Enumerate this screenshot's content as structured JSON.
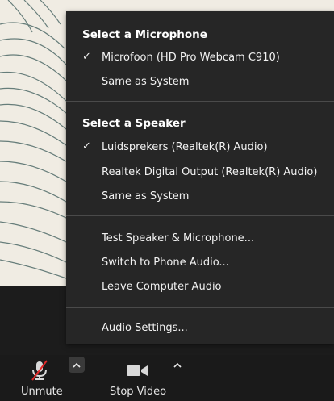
{
  "menu": {
    "microphone_header": "Select a Microphone",
    "microphones": [
      {
        "label": "Microfoon (HD Pro Webcam C910)",
        "checked": true
      },
      {
        "label": "Same as System",
        "checked": false
      }
    ],
    "speaker_header": "Select a Speaker",
    "speakers": [
      {
        "label": "Luidsprekers (Realtek(R) Audio)",
        "checked": true
      },
      {
        "label": "Realtek Digital Output (Realtek(R) Audio)",
        "checked": false
      },
      {
        "label": "Same as System",
        "checked": false
      }
    ],
    "actions": [
      {
        "label": "Test Speaker & Microphone..."
      },
      {
        "label": "Switch to Phone Audio..."
      },
      {
        "label": "Leave Computer Audio"
      }
    ],
    "settings": {
      "label": "Audio Settings..."
    },
    "check_glyph": "✓"
  },
  "toolbar": {
    "unmute_label": "Unmute",
    "stop_video_label": "Stop Video",
    "caret_glyph": "^"
  },
  "colors": {
    "menu_bg": "#262626",
    "mute_slash": "#e02828",
    "toolbar_bg": "#1a1a1a"
  }
}
